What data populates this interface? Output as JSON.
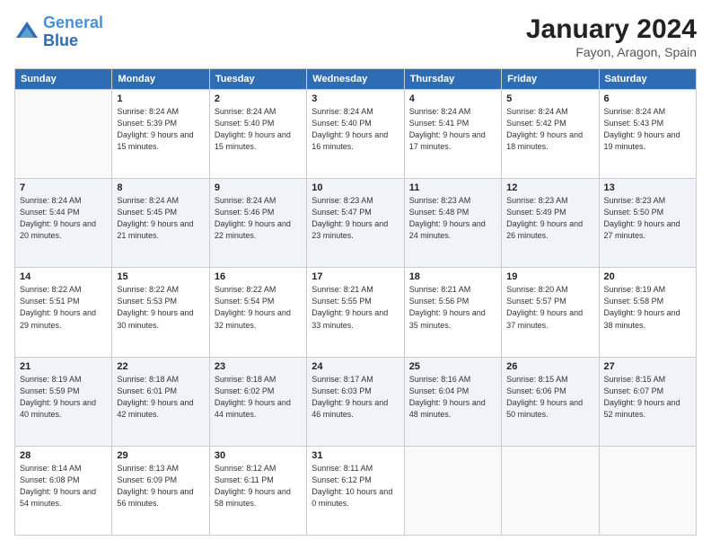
{
  "header": {
    "logo_line1": "General",
    "logo_line2": "Blue",
    "month_year": "January 2024",
    "location": "Fayon, Aragon, Spain"
  },
  "weekdays": [
    "Sunday",
    "Monday",
    "Tuesday",
    "Wednesday",
    "Thursday",
    "Friday",
    "Saturday"
  ],
  "weeks": [
    [
      {
        "day": "",
        "sunrise": "",
        "sunset": "",
        "daylight": ""
      },
      {
        "day": "1",
        "sunrise": "Sunrise: 8:24 AM",
        "sunset": "Sunset: 5:39 PM",
        "daylight": "Daylight: 9 hours and 15 minutes."
      },
      {
        "day": "2",
        "sunrise": "Sunrise: 8:24 AM",
        "sunset": "Sunset: 5:40 PM",
        "daylight": "Daylight: 9 hours and 15 minutes."
      },
      {
        "day": "3",
        "sunrise": "Sunrise: 8:24 AM",
        "sunset": "Sunset: 5:40 PM",
        "daylight": "Daylight: 9 hours and 16 minutes."
      },
      {
        "day": "4",
        "sunrise": "Sunrise: 8:24 AM",
        "sunset": "Sunset: 5:41 PM",
        "daylight": "Daylight: 9 hours and 17 minutes."
      },
      {
        "day": "5",
        "sunrise": "Sunrise: 8:24 AM",
        "sunset": "Sunset: 5:42 PM",
        "daylight": "Daylight: 9 hours and 18 minutes."
      },
      {
        "day": "6",
        "sunrise": "Sunrise: 8:24 AM",
        "sunset": "Sunset: 5:43 PM",
        "daylight": "Daylight: 9 hours and 19 minutes."
      }
    ],
    [
      {
        "day": "7",
        "sunrise": "Sunrise: 8:24 AM",
        "sunset": "Sunset: 5:44 PM",
        "daylight": "Daylight: 9 hours and 20 minutes."
      },
      {
        "day": "8",
        "sunrise": "Sunrise: 8:24 AM",
        "sunset": "Sunset: 5:45 PM",
        "daylight": "Daylight: 9 hours and 21 minutes."
      },
      {
        "day": "9",
        "sunrise": "Sunrise: 8:24 AM",
        "sunset": "Sunset: 5:46 PM",
        "daylight": "Daylight: 9 hours and 22 minutes."
      },
      {
        "day": "10",
        "sunrise": "Sunrise: 8:23 AM",
        "sunset": "Sunset: 5:47 PM",
        "daylight": "Daylight: 9 hours and 23 minutes."
      },
      {
        "day": "11",
        "sunrise": "Sunrise: 8:23 AM",
        "sunset": "Sunset: 5:48 PM",
        "daylight": "Daylight: 9 hours and 24 minutes."
      },
      {
        "day": "12",
        "sunrise": "Sunrise: 8:23 AM",
        "sunset": "Sunset: 5:49 PM",
        "daylight": "Daylight: 9 hours and 26 minutes."
      },
      {
        "day": "13",
        "sunrise": "Sunrise: 8:23 AM",
        "sunset": "Sunset: 5:50 PM",
        "daylight": "Daylight: 9 hours and 27 minutes."
      }
    ],
    [
      {
        "day": "14",
        "sunrise": "Sunrise: 8:22 AM",
        "sunset": "Sunset: 5:51 PM",
        "daylight": "Daylight: 9 hours and 29 minutes."
      },
      {
        "day": "15",
        "sunrise": "Sunrise: 8:22 AM",
        "sunset": "Sunset: 5:53 PM",
        "daylight": "Daylight: 9 hours and 30 minutes."
      },
      {
        "day": "16",
        "sunrise": "Sunrise: 8:22 AM",
        "sunset": "Sunset: 5:54 PM",
        "daylight": "Daylight: 9 hours and 32 minutes."
      },
      {
        "day": "17",
        "sunrise": "Sunrise: 8:21 AM",
        "sunset": "Sunset: 5:55 PM",
        "daylight": "Daylight: 9 hours and 33 minutes."
      },
      {
        "day": "18",
        "sunrise": "Sunrise: 8:21 AM",
        "sunset": "Sunset: 5:56 PM",
        "daylight": "Daylight: 9 hours and 35 minutes."
      },
      {
        "day": "19",
        "sunrise": "Sunrise: 8:20 AM",
        "sunset": "Sunset: 5:57 PM",
        "daylight": "Daylight: 9 hours and 37 minutes."
      },
      {
        "day": "20",
        "sunrise": "Sunrise: 8:19 AM",
        "sunset": "Sunset: 5:58 PM",
        "daylight": "Daylight: 9 hours and 38 minutes."
      }
    ],
    [
      {
        "day": "21",
        "sunrise": "Sunrise: 8:19 AM",
        "sunset": "Sunset: 5:59 PM",
        "daylight": "Daylight: 9 hours and 40 minutes."
      },
      {
        "day": "22",
        "sunrise": "Sunrise: 8:18 AM",
        "sunset": "Sunset: 6:01 PM",
        "daylight": "Daylight: 9 hours and 42 minutes."
      },
      {
        "day": "23",
        "sunrise": "Sunrise: 8:18 AM",
        "sunset": "Sunset: 6:02 PM",
        "daylight": "Daylight: 9 hours and 44 minutes."
      },
      {
        "day": "24",
        "sunrise": "Sunrise: 8:17 AM",
        "sunset": "Sunset: 6:03 PM",
        "daylight": "Daylight: 9 hours and 46 minutes."
      },
      {
        "day": "25",
        "sunrise": "Sunrise: 8:16 AM",
        "sunset": "Sunset: 6:04 PM",
        "daylight": "Daylight: 9 hours and 48 minutes."
      },
      {
        "day": "26",
        "sunrise": "Sunrise: 8:15 AM",
        "sunset": "Sunset: 6:06 PM",
        "daylight": "Daylight: 9 hours and 50 minutes."
      },
      {
        "day": "27",
        "sunrise": "Sunrise: 8:15 AM",
        "sunset": "Sunset: 6:07 PM",
        "daylight": "Daylight: 9 hours and 52 minutes."
      }
    ],
    [
      {
        "day": "28",
        "sunrise": "Sunrise: 8:14 AM",
        "sunset": "Sunset: 6:08 PM",
        "daylight": "Daylight: 9 hours and 54 minutes."
      },
      {
        "day": "29",
        "sunrise": "Sunrise: 8:13 AM",
        "sunset": "Sunset: 6:09 PM",
        "daylight": "Daylight: 9 hours and 56 minutes."
      },
      {
        "day": "30",
        "sunrise": "Sunrise: 8:12 AM",
        "sunset": "Sunset: 6:11 PM",
        "daylight": "Daylight: 9 hours and 58 minutes."
      },
      {
        "day": "31",
        "sunrise": "Sunrise: 8:11 AM",
        "sunset": "Sunset: 6:12 PM",
        "daylight": "Daylight: 10 hours and 0 minutes."
      },
      {
        "day": "",
        "sunrise": "",
        "sunset": "",
        "daylight": ""
      },
      {
        "day": "",
        "sunrise": "",
        "sunset": "",
        "daylight": ""
      },
      {
        "day": "",
        "sunrise": "",
        "sunset": "",
        "daylight": ""
      }
    ]
  ]
}
